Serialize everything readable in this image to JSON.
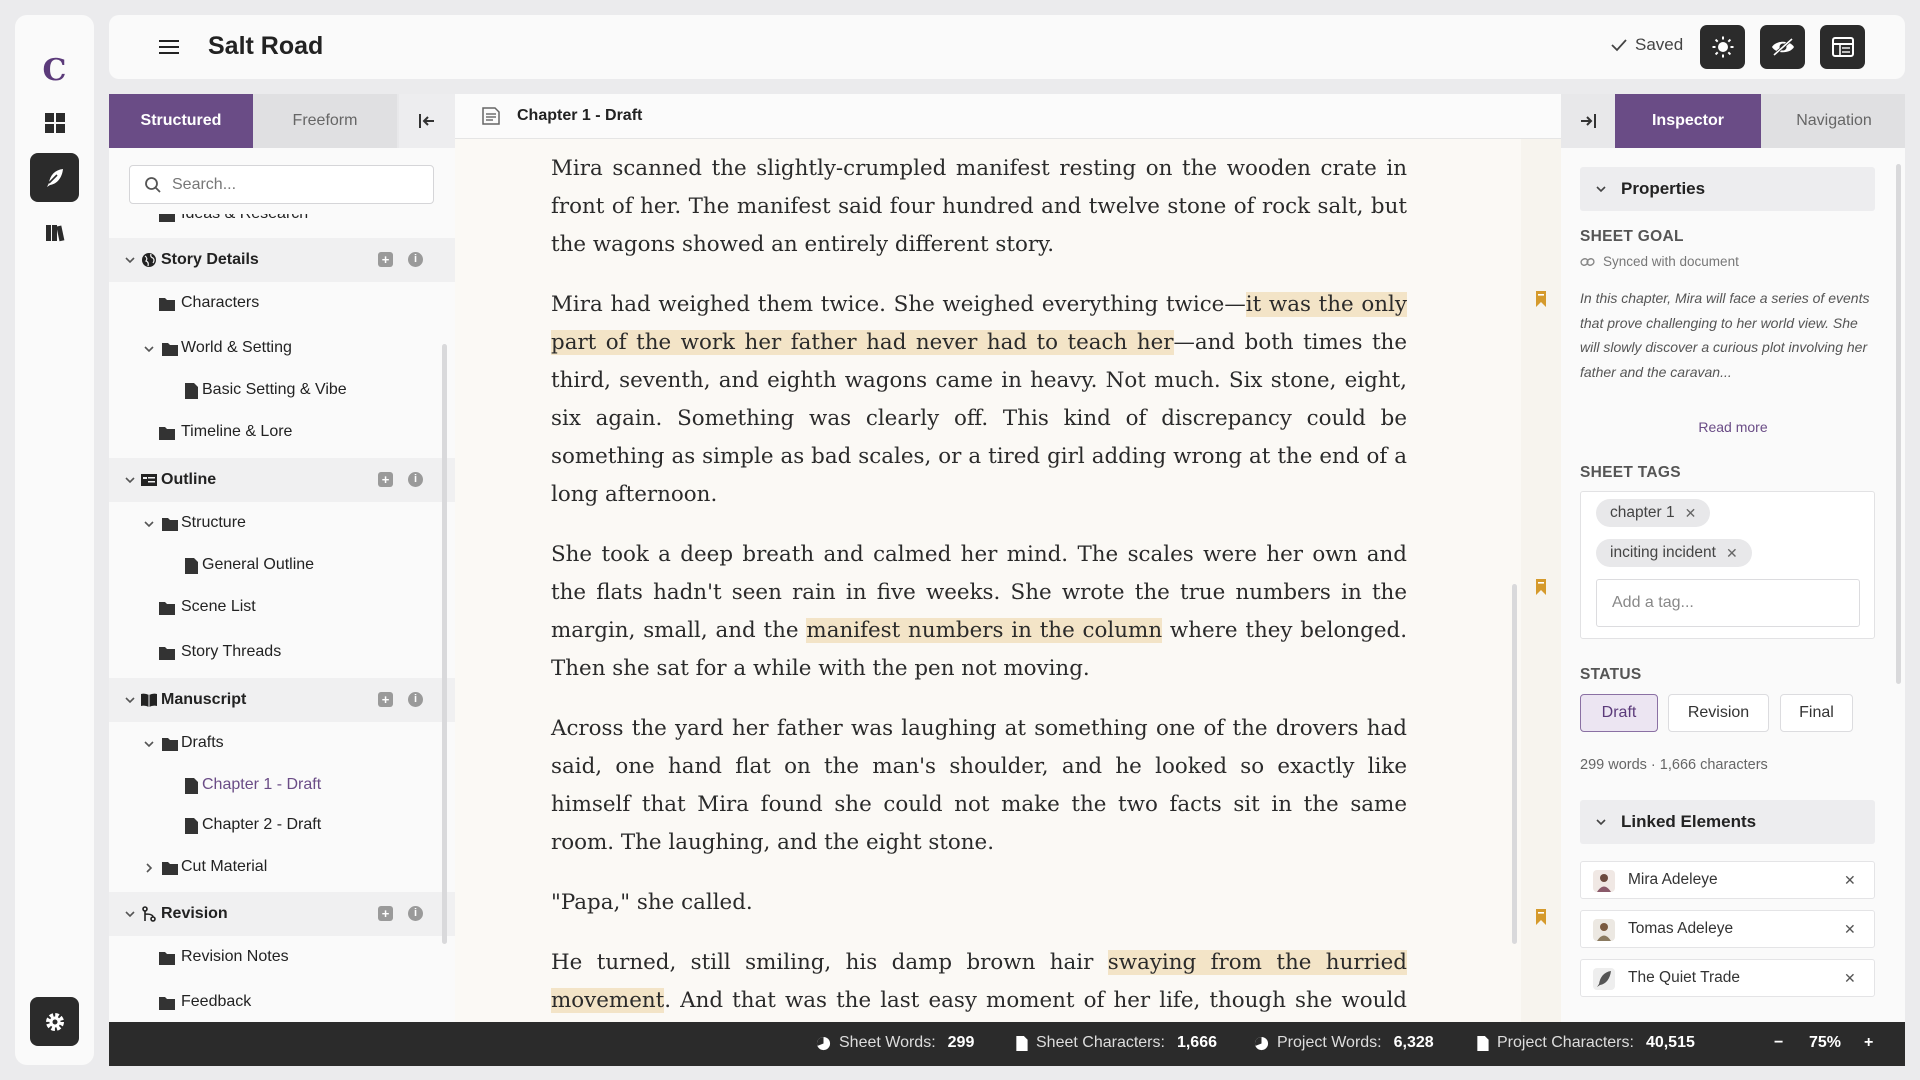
{
  "app": {
    "logo": "C",
    "title": "Salt Road",
    "saved_label": "Saved"
  },
  "rail": {
    "items": [
      "dashboard-icon",
      "quill-icon",
      "books-icon"
    ],
    "settings_icon": "gear-icon"
  },
  "left_panel": {
    "tabs": [
      {
        "label": "Structured",
        "active": true
      },
      {
        "label": "Freeform",
        "active": false
      }
    ],
    "search": {
      "placeholder": "Search..."
    },
    "tree": [
      {
        "label": "Ideas & Research",
        "type": "folder"
      },
      {
        "label": "Story Details",
        "type": "section"
      },
      {
        "label": "Characters",
        "type": "folder"
      },
      {
        "label": "World & Setting",
        "type": "folder"
      },
      {
        "label": "Basic Setting & Vibe",
        "type": "doc"
      },
      {
        "label": "Timeline & Lore",
        "type": "folder"
      },
      {
        "label": "Outline",
        "type": "section"
      },
      {
        "label": "Structure",
        "type": "folder"
      },
      {
        "label": "General Outline",
        "type": "doc"
      },
      {
        "label": "Scene List",
        "type": "folder"
      },
      {
        "label": "Story Threads",
        "type": "folder"
      },
      {
        "label": "Manuscript",
        "type": "section"
      },
      {
        "label": "Drafts",
        "type": "folder"
      },
      {
        "label": "Chapter 1 - Draft",
        "type": "doc",
        "selected": true
      },
      {
        "label": "Chapter 2 - Draft",
        "type": "doc"
      },
      {
        "label": "Cut Material",
        "type": "folder"
      },
      {
        "label": "Revision",
        "type": "section"
      },
      {
        "label": "Revision Notes",
        "type": "folder"
      },
      {
        "label": "Feedback",
        "type": "folder"
      }
    ]
  },
  "editor": {
    "doc_title": "Chapter 1 - Draft",
    "paragraphs": [
      {
        "segments": [
          {
            "text": "Mira scanned the slightly-crumpled manifest resting on the wooden crate in front of her. The manifest said four hundred and twelve stone of rock salt, but the wagons showed an entirely different story."
          }
        ]
      },
      {
        "segments": [
          {
            "text": "Mira had weighed them twice. She weighed everything twice—"
          },
          {
            "text": "it was the only part of the work her father had never had to teach her",
            "hl": true
          },
          {
            "text": "—and both times the third, seventh, and eighth wagons came in heavy. Not much. Six stone, eight, six again. Something was clearly off. This kind of discrepancy could be something as simple as bad scales, or a tired girl adding wrong at the end of a long afternoon."
          }
        ]
      },
      {
        "segments": [
          {
            "text": "She took a deep breath and calmed her mind. The scales were her own and the flats hadn't seen rain in five weeks. She wrote the true numbers in the margin, small, and the "
          },
          {
            "text": "manifest numbers in the column",
            "hl": true
          },
          {
            "text": " where they belonged. Then she sat for a while with the pen not moving."
          }
        ]
      },
      {
        "segments": [
          {
            "text": "Across the yard her father was laughing at something one of the drovers had said, one hand flat on the man's shoulder, and he looked so exactly like himself that Mira found she could not make the two facts sit in the same room. The laughing, and the eight stone."
          }
        ]
      },
      {
        "segments": [
          {
            "text": "\"Papa,\" she called."
          }
        ]
      },
      {
        "segments": [
          {
            "text": "He turned, still smiling, his damp brown hair "
          },
          {
            "text": "swaying from the hurried movement",
            "hl": true
          },
          {
            "text": ". And that was the last easy moment of her life, though she would not know it for another eleven days."
          }
        ],
        "cursor": true
      }
    ]
  },
  "right_panel": {
    "tabs": [
      {
        "label": "Inspector",
        "active": true
      },
      {
        "label": "Navigation",
        "active": false
      }
    ],
    "properties_title": "Properties",
    "sheet_goal_label": "SHEET GOAL",
    "synced_label": "Synced with document",
    "goal_text": "In this chapter, Mira will face a series of events that prove challenging to her world view. She will slowly discover a curious plot involving her father and the caravan...",
    "read_more": "Read more",
    "sheet_tags_label": "SHEET TAGS",
    "tags": [
      "chapter 1",
      "inciting incident"
    ],
    "tag_placeholder": "Add a tag...",
    "status_label": "STATUS",
    "status_options": [
      {
        "label": "Draft",
        "selected": true
      },
      {
        "label": "Revision",
        "selected": false
      },
      {
        "label": "Final",
        "selected": false
      }
    ],
    "counts_text": "299 words · 1,666 characters",
    "linked_title": "Linked Elements",
    "linked": [
      "Mira Adeleye",
      "Tomas Adeleye",
      "The Quiet Trade"
    ]
  },
  "status_bar": {
    "sheet_words_label": "Sheet Words:",
    "sheet_words": "299",
    "sheet_chars_label": "Sheet Characters:",
    "sheet_chars": "1,666",
    "project_words_label": "Project Words:",
    "project_words": "6,328",
    "project_chars_label": "Project Characters:",
    "project_chars": "40,515",
    "zoom_minus": "−",
    "zoom": "75%",
    "zoom_plus": "+"
  },
  "colors": {
    "accent": "#6a4c86",
    "dark": "#2b2b2b",
    "highlight": "#f3e4c7",
    "bookmark": "#d59a2c"
  }
}
